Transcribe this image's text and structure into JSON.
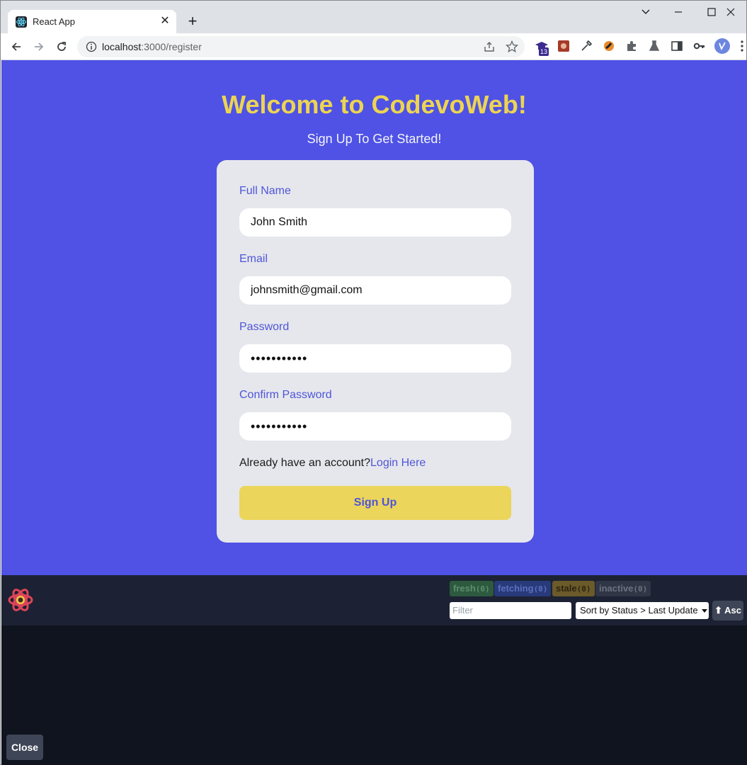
{
  "browser": {
    "tab_title": "React App",
    "tab_close": "✕",
    "new_tab": "+",
    "url_host": "localhost",
    "url_path": ":3000/register",
    "notification_count": "13"
  },
  "page": {
    "welcome": "Welcome to CodevoWeb!",
    "subtitle": "Sign Up To Get Started!",
    "form": {
      "full_name_label": "Full Name",
      "full_name_value": "John Smith",
      "email_label": "Email",
      "email_value": "johnsmith@gmail.com",
      "password_label": "Password",
      "password_value": "•••••••••••",
      "confirm_label": "Confirm Password",
      "confirm_value": "•••••••••••",
      "account_prompt": "Already have an account?",
      "login_link": "Login Here",
      "submit_label": "Sign Up"
    }
  },
  "devtools": {
    "badges": [
      {
        "label": "fresh",
        "count": "(0)",
        "color": "#2d5a3e",
        "text_color": "#5b8f6c"
      },
      {
        "label": "fetching",
        "count": "(0)",
        "color": "#283a7a",
        "text_color": "#5c6fbf"
      },
      {
        "label": "stale",
        "count": "(0)",
        "color": "#6b5a2a",
        "text_color": "#2b2410"
      },
      {
        "label": "inactive",
        "count": "(0)",
        "color": "#303645",
        "text_color": "#6b7280"
      }
    ],
    "filter_placeholder": "Filter",
    "sort_label": "Sort by Status > Last Update",
    "asc_label": "⬆ Asc",
    "close_label": "Close"
  },
  "colors": {
    "page_bg": "#4f52e5",
    "title": "#ecd452",
    "accent": "#5055d8",
    "button": "#ebd55a"
  }
}
